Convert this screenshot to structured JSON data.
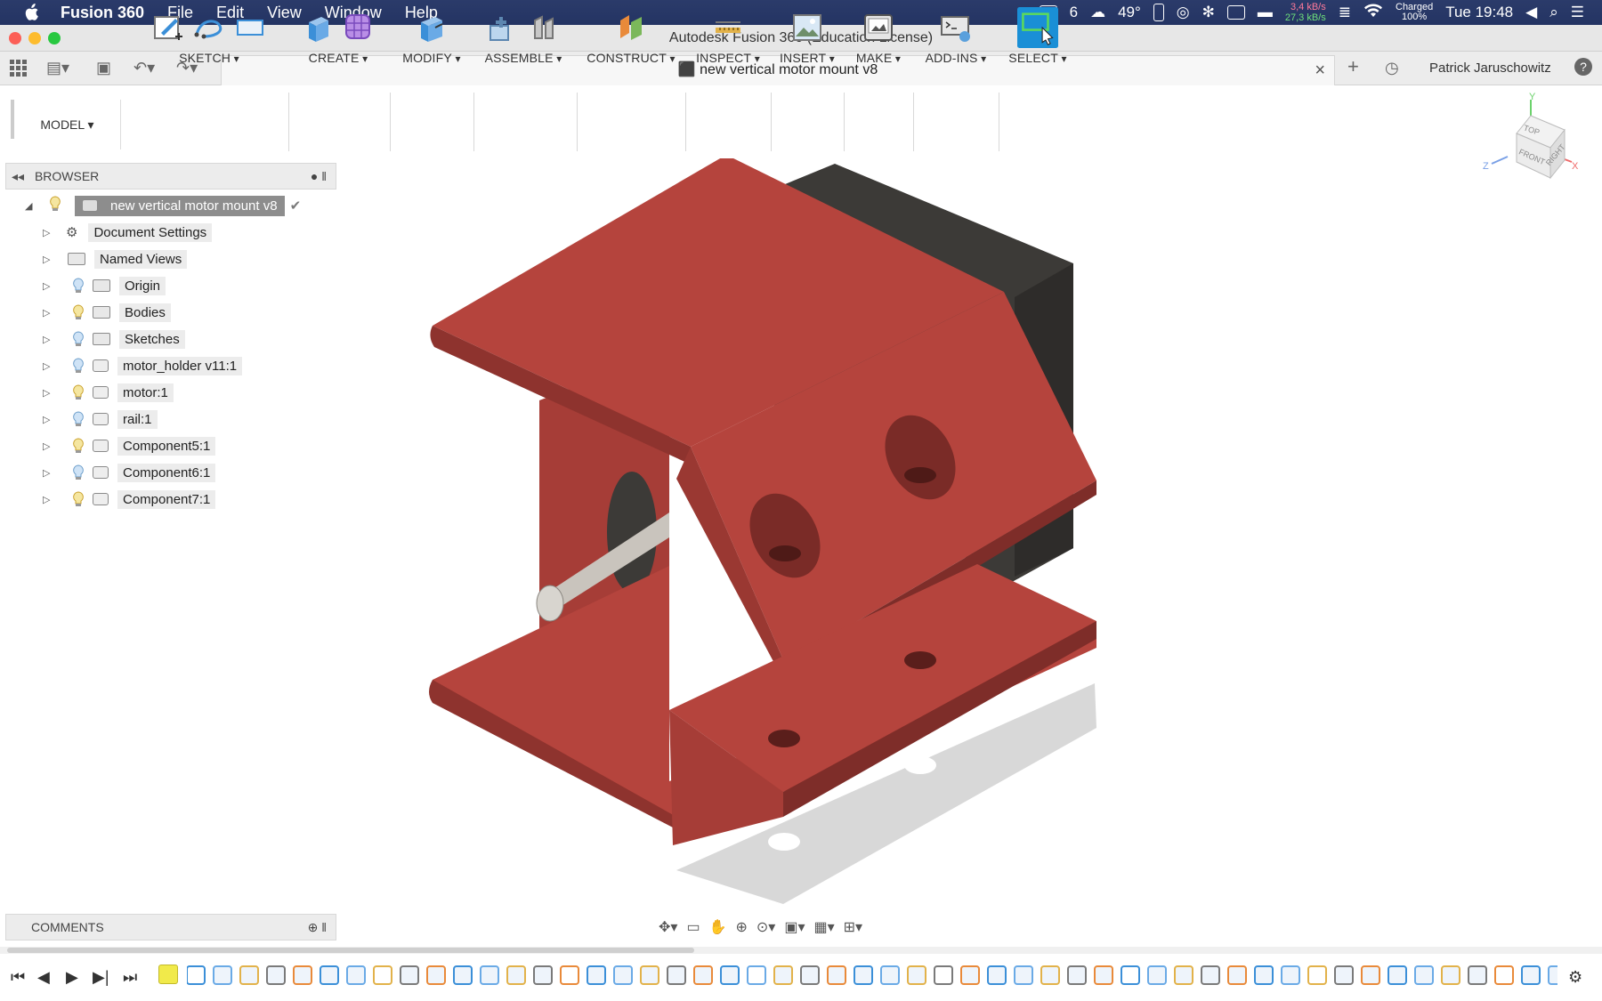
{
  "menubar": {
    "app_name": "Fusion 360",
    "menus": [
      "File",
      "Edit",
      "View",
      "Window",
      "Help"
    ],
    "tray": {
      "count": "6",
      "temperature": "49°",
      "net_up": "3,4 kB/s",
      "net_down": "27,3 kB/s",
      "battery_status": "Charged",
      "battery_level": "100%",
      "clock": "Tue 19:48"
    }
  },
  "window": {
    "title": "Autodesk Fusion 360 (Education License)"
  },
  "tabbar": {
    "document_tab": "new vertical motor mount v8",
    "user_name": "Patrick Jaruschowitz"
  },
  "toolbar": {
    "workspace": "MODEL",
    "groups": [
      "SKETCH",
      "CREATE",
      "MODIFY",
      "ASSEMBLE",
      "CONSTRUCT",
      "INSPECT",
      "INSERT",
      "MAKE",
      "ADD-INS",
      "SELECT"
    ]
  },
  "browser": {
    "title": "BROWSER",
    "root": "new vertical motor mount v8",
    "items": [
      {
        "label": "Document Settings",
        "icon": "gear-icon"
      },
      {
        "label": "Named Views",
        "icon": "folder-icon"
      },
      {
        "label": "Origin",
        "icon": "folder-icon"
      },
      {
        "label": "Bodies",
        "icon": "folder-icon"
      },
      {
        "label": "Sketches",
        "icon": "folder-icon"
      },
      {
        "label": "motor_holder v11:1",
        "icon": "component-icon"
      },
      {
        "label": "motor:1",
        "icon": "component-icon"
      },
      {
        "label": "rail:1",
        "icon": "component-icon"
      },
      {
        "label": "Component5:1",
        "icon": "component-icon"
      },
      {
        "label": "Component6:1",
        "icon": "component-icon"
      },
      {
        "label": "Component7:1",
        "icon": "component-icon"
      }
    ]
  },
  "viewcube": {
    "faces": [
      "TOP",
      "FRONT",
      "RIGHT"
    ],
    "axes": [
      "Y",
      "Z",
      "X"
    ]
  },
  "comments": {
    "title": "COMMENTS"
  },
  "colors": {
    "menubar": "#243463",
    "part_red": "#b5443d",
    "motor_dark": "#3c3a37",
    "select_blue": "#1a8fd6"
  }
}
